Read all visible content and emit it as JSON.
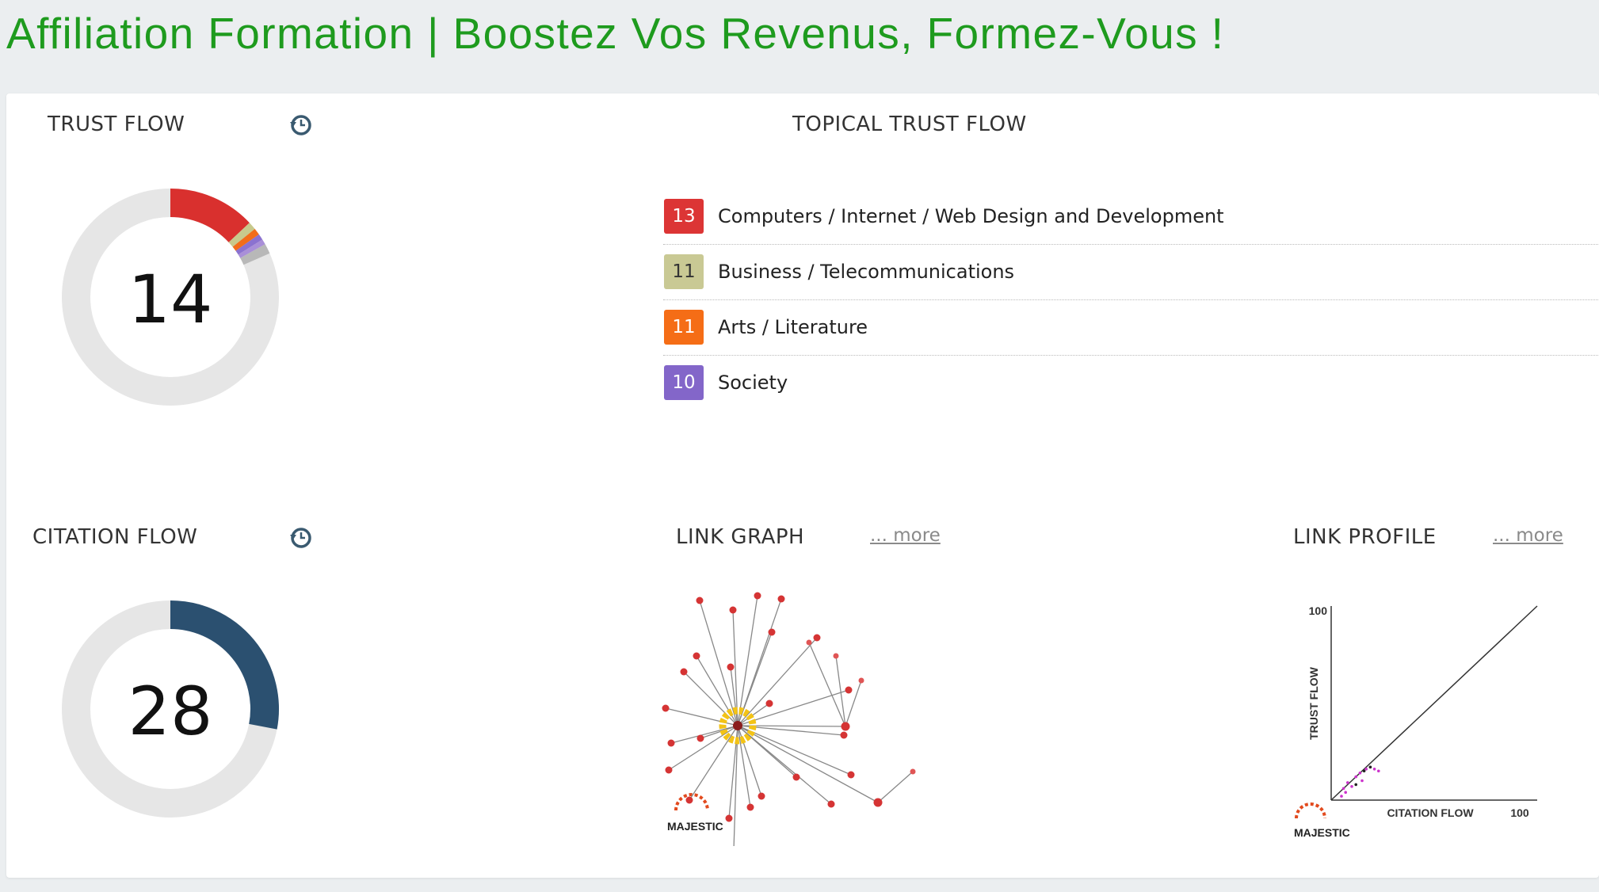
{
  "page": {
    "title": "Affiliation Formation | Boostez Vos Revenus, Formez-Vous !"
  },
  "colors": {
    "title_green": "#1e9b1e",
    "trust_flow_red": "#d9302e",
    "citation_flow_blue": "#2b5070",
    "ring_gray": "#e6e6e6"
  },
  "trust_flow": {
    "heading": "TRUST FLOW",
    "value": "14",
    "icon": "history-icon",
    "segments": [
      {
        "color": "#d9302e",
        "value": 13
      },
      {
        "color": "#c8c98c",
        "value": 1.2
      },
      {
        "color": "#f26d1a",
        "value": 1
      },
      {
        "color": "#8b72d0",
        "value": 0.9
      },
      {
        "color": "#a98fd8",
        "value": 0.8
      },
      {
        "color": "#b8b8b8",
        "value": 1.5
      }
    ]
  },
  "citation_flow": {
    "heading": "CITATION FLOW",
    "value": "28",
    "icon": "history-icon"
  },
  "topical_trust_flow": {
    "heading": "TOPICAL TRUST FLOW",
    "items": [
      {
        "score": "13",
        "label": "Computers / Internet / Web Design and Development",
        "color": "#dc3535"
      },
      {
        "score": "11",
        "label": "Business / Telecommunications",
        "color": "#c9c994",
        "text_color": "#333333"
      },
      {
        "score": "11",
        "label": "Arts / Literature",
        "color": "#f56d16"
      },
      {
        "score": "10",
        "label": "Society",
        "color": "#8366c9"
      }
    ]
  },
  "link_graph": {
    "heading": "LINK GRAPH",
    "more": "... more",
    "logo_text": "MAJESTIC"
  },
  "link_profile": {
    "heading": "LINK PROFILE",
    "more": "... more",
    "logo_text": "MAJESTIC",
    "x_axis_label": "CITATION FLOW",
    "y_axis_label": "TRUST FLOW",
    "x_max_label": "100",
    "y_max_label": "100"
  },
  "chart_data": [
    {
      "type": "pie",
      "title": "TRUST FLOW",
      "center_value": 14,
      "max": 100
    },
    {
      "type": "pie",
      "title": "CITATION FLOW",
      "center_value": 28,
      "max": 100
    },
    {
      "type": "scatter",
      "title": "LINK PROFILE",
      "xlabel": "CITATION FLOW",
      "ylabel": "TRUST FLOW",
      "xlim": [
        0,
        100
      ],
      "ylim": [
        0,
        100
      ],
      "reference_line": "diagonal",
      "series": [
        {
          "color": "#cc33cc",
          "points": [
            [
              7,
              4
            ],
            [
              8,
              9
            ],
            [
              10,
              7
            ],
            [
              12,
              12
            ],
            [
              14,
              14
            ],
            [
              15,
              10
            ],
            [
              17,
              16
            ],
            [
              19,
              17
            ],
            [
              21,
              16
            ],
            [
              23,
              15
            ],
            [
              5,
              2
            ],
            [
              6,
              6
            ]
          ]
        },
        {
          "color": "#222222",
          "points": [
            [
              16,
              15
            ],
            [
              19,
              17
            ],
            [
              12,
              8
            ]
          ]
        }
      ]
    }
  ]
}
